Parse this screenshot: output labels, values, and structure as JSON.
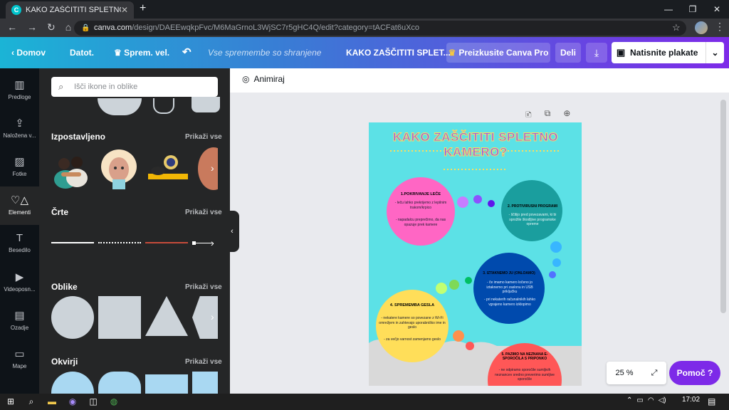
{
  "browser": {
    "tab_title": "KAKO ZAŠČITITI SPLETNO KAMER",
    "tab_favicon": "C",
    "url_host": "canva.com",
    "url_path": "/design/DAEEwqkpFvc/M6MaGrnoL3WjSC7r5gHC4Q/edit?category=tACFat6uXco"
  },
  "toolbar": {
    "home": "Domov",
    "file": "Datot.",
    "resize": "Sprem. vel.",
    "saved_status": "Vse spremembe so shranjene",
    "doc_title": "KAKO ZAŠČITITI SPLET...",
    "try_pro": "Preizkusite Canva Pro",
    "share": "Deli",
    "print": "Natisnite plakate"
  },
  "rail": [
    {
      "label": "Predloge",
      "icon": "template-icon"
    },
    {
      "label": "Naložena v...",
      "icon": "upload-icon"
    },
    {
      "label": "Fotke",
      "icon": "photo-icon"
    },
    {
      "label": "Elementi",
      "icon": "elements-icon"
    },
    {
      "label": "Besedilo",
      "icon": "text-icon"
    },
    {
      "label": "Videoposn...",
      "icon": "video-icon"
    },
    {
      "label": "Ozadje",
      "icon": "background-icon"
    },
    {
      "label": "Mape",
      "icon": "folder-icon"
    }
  ],
  "panel": {
    "search_placeholder": "Išči ikone in oblike",
    "featured": "Izpostavljeno",
    "lines": "Črte",
    "shapes": "Oblike",
    "frames": "Okvirji",
    "show_all": "Prikaži vse"
  },
  "canvas": {
    "animate": "Animiraj",
    "zoom": "25 %",
    "help": "Pomoč ?"
  },
  "poster": {
    "title": "KAKO ZAŠČITITI SPLETNO KAMERO?",
    "c1_title": "1.POKRIVANJE LEČE",
    "c1_text1": "- leču lahko prekrijemo z lepilnim trakom/krpico",
    "c1_text2": "- napadalcu preprečimo, da nas opazuje prek kamere",
    "c2_title": "2. PROTIVIRUSNI PROGRAMI",
    "c2_text": "- ščitijo pred povezavami, ki bi sprožile škodljive programske opreme",
    "c3_title": "3. IZTAKNEMO JU (ONLOAMO)",
    "c3_text1": "- če imamo kamero ločeno jo iztaknemo pri zaslonu in USB priključku",
    "c3_text2": "- pri nekaterih računalnikih lahko vgrajeno kamero izklopimo",
    "c4_title": "4. SPREMEMBA GESLA",
    "c4_text1": "- nekatere kamere so povezane z Wi-Fi omrežjem in zahtevajo uporabniško ime in geslo",
    "c4_text2": "- za večjo varnost zamenjamo geslo",
    "c5_title": "5. PAZIMO NA NEZNANA E-SPOROČILA S PRIPONKO",
    "c5_text": "- ne odpiramo sporočile sumljivih neznancev sredno preverimo sumljive sporočile"
  },
  "taskbar": {
    "time": "17:02"
  },
  "colors": {
    "canva_purple": "#7d2ae8",
    "canva_teal": "#1bb4d6",
    "poster_bg": "#5ce1e6",
    "circle_pink": "#ff66c4",
    "circle_teal": "#1a9e9e",
    "circle_blue": "#004aad",
    "circle_yellow": "#ffde59",
    "circle_red": "#ff5757"
  }
}
